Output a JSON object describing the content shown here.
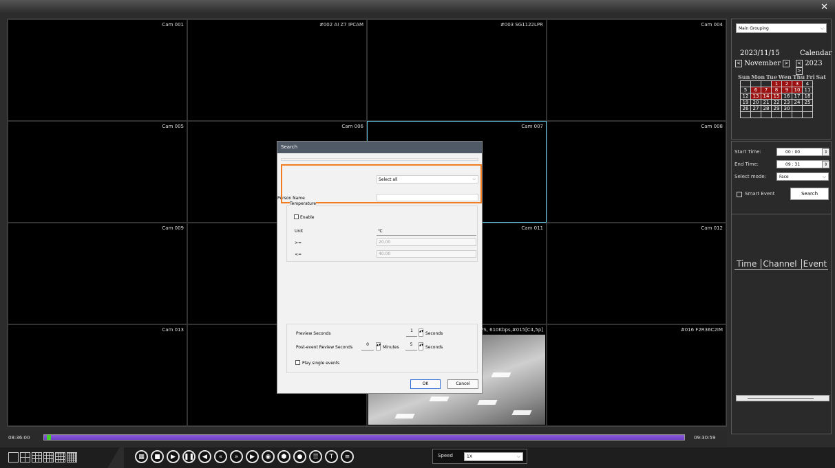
{
  "window": {
    "close": "✕"
  },
  "cameras": [
    "Cam 001",
    "#002 AI Z7 IPCAM",
    "#003 SG1122LPR",
    "Cam 004",
    "Cam 005",
    "Cam 006",
    "Cam 007",
    "Cam 008",
    "Cam 009",
    "",
    "Cam 011",
    "Cam 012",
    "Cam 013",
    "",
    "PS, 610Kbps,#015[C4,5p]",
    "#016 F2R36C2IM"
  ],
  "sidebar": {
    "grouping": "Main Grouping",
    "calendar": {
      "date": "2023/11/15",
      "title": "Calendar",
      "month": "November",
      "year": "2023",
      "prev": "<",
      "next": ">",
      "days_of_week": [
        "Sun",
        "Mon",
        "Tue",
        "Wen",
        "Thu",
        "Fri",
        "Sat"
      ],
      "weeks": [
        [
          "",
          "",
          "",
          "1",
          "2",
          "3",
          "4"
        ],
        [
          "5",
          "6",
          "7",
          "8",
          "9",
          "10",
          "11"
        ],
        [
          "12",
          "13",
          "14",
          "15",
          "16",
          "17",
          "18"
        ],
        [
          "19",
          "20",
          "21",
          "22",
          "23",
          "24",
          "25"
        ],
        [
          "26",
          "27",
          "28",
          "29",
          "30",
          "",
          ""
        ],
        [
          "",
          "",
          "",
          "",
          "",
          "",
          ""
        ]
      ],
      "highlighted": [
        "1",
        "2",
        "3",
        "6",
        "7",
        "8",
        "9",
        "10",
        "13",
        "14",
        "15"
      ]
    },
    "start_time_label": "Start Time:",
    "start_time": "00 : 00",
    "end_time_label": "End Time:",
    "end_time": "09 : 31",
    "select_mode_label": "Select mode:",
    "select_mode": "Face",
    "smart_event_label": "Smart Event",
    "search_label": "Search",
    "events_headers": [
      "Time",
      "Channel",
      "Event"
    ]
  },
  "timeline": {
    "start": "08:36:00",
    "end": "09:30:59",
    "progress": 0.004
  },
  "controls": {
    "buttons": [
      "grid-icon",
      "stop-icon",
      "play-icon",
      "pause-icon",
      "step-back-icon",
      "rewind-icon",
      "fast-forward-icon",
      "step-forward-icon",
      "record-icon",
      "snapshot-icon",
      "camera-icon",
      "list-icon",
      "text-icon",
      "menu-icon"
    ],
    "speed_label": "Speed",
    "speed": "1X"
  },
  "dialog": {
    "title": "Search",
    "select_all": "Select all",
    "person_name_label": "Person Name",
    "person_name": "",
    "temperature_label": "Temperature",
    "enable_label": "Enable",
    "unit_label": "Unit",
    "unit_value": "℃",
    "gte_label": ">=",
    "gte_value": "20.00",
    "lte_label": "<=",
    "lte_value": "40.00",
    "preview_label": "Preview Seconds",
    "preview_value": "1",
    "seconds_label": "Seconds",
    "post_label": "Post-event Review Seconds",
    "post_minutes": "0",
    "minutes_label": "Minutes",
    "post_seconds": "5",
    "play_single_label": "Play single events",
    "ok": "OK",
    "cancel": "Cancel"
  }
}
